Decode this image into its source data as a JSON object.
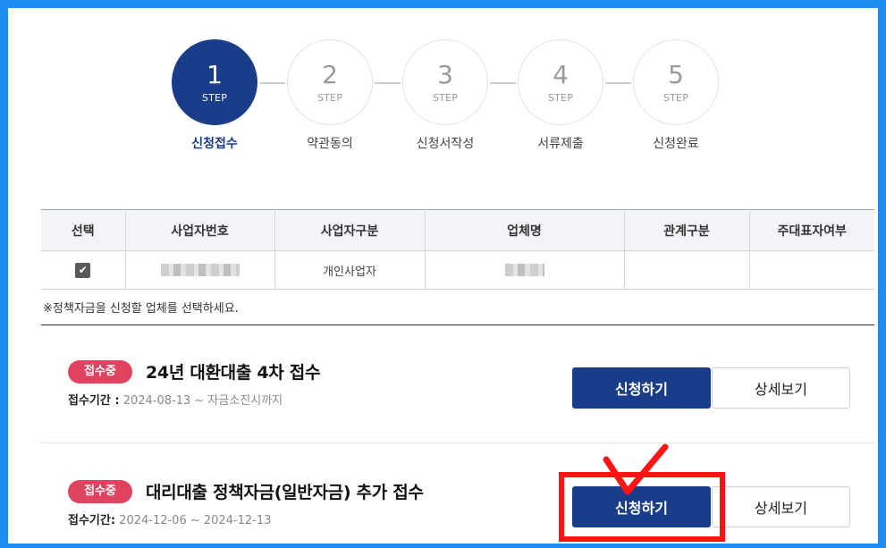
{
  "steps": [
    {
      "num": "1",
      "sub": "STEP",
      "label": "신청접수"
    },
    {
      "num": "2",
      "sub": "STEP",
      "label": "약관동의"
    },
    {
      "num": "3",
      "sub": "STEP",
      "label": "신청서작성"
    },
    {
      "num": "4",
      "sub": "STEP",
      "label": "서류제출"
    },
    {
      "num": "5",
      "sub": "STEP",
      "label": "신청완료"
    }
  ],
  "table": {
    "headers": [
      "선택",
      "사업자번호",
      "사업자구분",
      "업체명",
      "관계구분",
      "주대표자여부"
    ],
    "row": {
      "checked": "✔",
      "business_type": "개인사업자",
      "relation": "",
      "main_rep": ""
    }
  },
  "note": "※정책자금을 신청할 업체를 선택하세요.",
  "programs": [
    {
      "badge": "접수중",
      "title": "24년 대환대출 4차 접수",
      "period_label": "접수기간 :",
      "period_value": " 2024-08-13 ~ 자금소진시까지",
      "apply_label": "신청하기",
      "detail_label": "상세보기"
    },
    {
      "badge": "접수중",
      "title": "대리대출 정책자금(일반자금) 추가 접수",
      "period_label": "접수기간:",
      "period_value": " 2024-12-06 ~ 2024-12-13",
      "apply_label": "신청하기",
      "detail_label": "상세보기"
    }
  ],
  "colors": {
    "primary": "#1a3d8a",
    "badge": "#e0435f",
    "frame": "#1e8bf0",
    "highlight": "#ff1414"
  }
}
